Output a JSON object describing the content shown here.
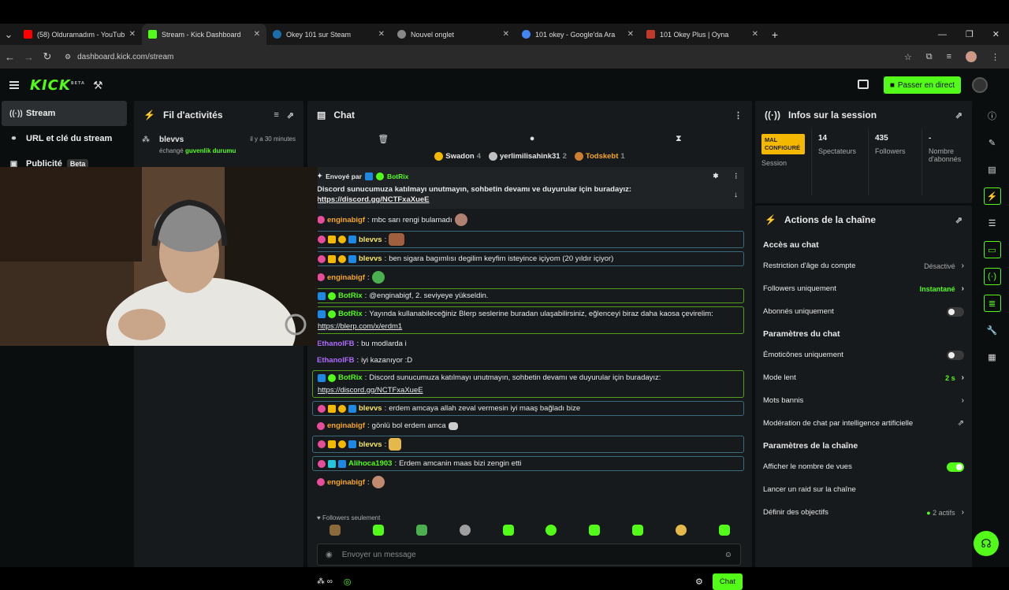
{
  "browser": {
    "tabs": [
      {
        "title": "(58) Olduramadım - YouTube",
        "color": "#ff0000"
      },
      {
        "title": "Stream - Kick Dashboard",
        "color": "#53fc18",
        "active": true
      },
      {
        "title": "Okey 101 sur Steam",
        "color": "#1b6ea8"
      },
      {
        "title": "Nouvel onglet",
        "color": "#888888"
      },
      {
        "title": "101 okey - Google'da Ara",
        "color": "#4285f4"
      },
      {
        "title": "101 Okey Plus | Oyna",
        "color": "#c0392b"
      }
    ],
    "url": "dashboard.kick.com/stream"
  },
  "header": {
    "logo": "KICK",
    "logo_sup": "BETA",
    "go_live": "Passer en direct"
  },
  "sidebar": {
    "items": [
      {
        "label": "Stream",
        "icon": "broadcast-icon"
      },
      {
        "label": "URL et clé du stream",
        "icon": "link-icon"
      },
      {
        "label": "Publicité",
        "icon": "ad-icon",
        "badge": "Beta"
      }
    ]
  },
  "activity": {
    "title": "Fil d'activités",
    "items": [
      {
        "user": "blevvs",
        "action": "échangé",
        "reward": "guvenlik durumu",
        "time": "il y a 30 minutes"
      }
    ]
  },
  "chat": {
    "title": "Chat",
    "top_gifters": [
      {
        "name": "Swadon",
        "count": "4",
        "color": "#f5b800"
      },
      {
        "name": "yerlimilisahink31",
        "count": "2",
        "color": "#c0c0c0"
      },
      {
        "name": "Todskebt",
        "count": "1",
        "color": "#cd7f32"
      }
    ],
    "pinned": {
      "label": "Envoyé par",
      "user": "BotRix",
      "text": "Discord sunucumuza katılmayı unutmayın, sohbetin devamı ve duyurular için buradayız:",
      "link": "https://discord.gg/NCTFxaXueE"
    },
    "messages": [
      {
        "user": "enginabigf",
        "color": "#f5a623",
        "text": "mbc sarı rengi bulamadı"
      },
      {
        "user": "blevvs",
        "color": "#f5e663",
        "text": ""
      },
      {
        "user": "blevvs",
        "color": "#f5e663",
        "text": "ben sigara bagımlısı degilim keyfim isteyince içiyom (20 yıldır içiyor)"
      },
      {
        "user": "enginabigf",
        "color": "#f5a623",
        "text": ""
      },
      {
        "user": "BotRix",
        "color": "#53fc18",
        "text": "@enginabigf, 2. seviyeye yükseldin."
      },
      {
        "user": "BotRix",
        "color": "#53fc18",
        "text": "Yayında kullanabileceğiniz Blerp seslerine buradan ulaşabilirsiniz, eğlenceyi biraz daha kaosa çevirelim:",
        "link": "https://blerp.com/x/erdm1"
      },
      {
        "user": "EthanolFB",
        "color": "#b06cff",
        "text": "bu modlarda i"
      },
      {
        "user": "EthanolFB",
        "color": "#b06cff",
        "text": "iyi kazanıyor :D"
      },
      {
        "user": "BotRix",
        "color": "#53fc18",
        "text": "Discord sunucumuza katılmayı unutmayın, sohbetin devamı ve duyurular için buradayız:",
        "link": "https://discord.gg/NCTFxaXueE"
      },
      {
        "user": "blevvs",
        "color": "#f5e663",
        "text": "erdem amcaya allah zeval vermesin iyi maaş bağladı bize"
      },
      {
        "user": "enginabigf",
        "color": "#f5a623",
        "text": "gönlü bol erdem amca"
      },
      {
        "user": "blevvs",
        "color": "#f5e663",
        "text": ""
      },
      {
        "user": "Alihoca1903",
        "color": "#53fc18",
        "text": "Erdem amcanin maas bizi zengin etti"
      },
      {
        "user": "enginabigf",
        "color": "#f5a623",
        "text": ""
      }
    ],
    "followers_only": "Followers seulement",
    "input_placeholder": "Envoyer un message",
    "send_label": "Chat"
  },
  "session": {
    "title": "Infos sur la session",
    "status": "MAL CONFIGURÉ",
    "status_label": "Session",
    "viewers": "14",
    "viewers_label": "Spectateurs",
    "followers": "435",
    "followers_label": "Followers",
    "subs": "-",
    "subs_label": "Nombre d'abonnés"
  },
  "actions": {
    "title": "Actions de la chaîne",
    "chat_access": "Accès au chat",
    "age_restriction": "Restriction d'âge du compte",
    "age_restriction_value": "Désactivé",
    "followers_only": "Followers uniquement",
    "followers_only_value": "Instantané",
    "subs_only": "Abonnés uniquement",
    "chat_settings": "Paramètres du chat",
    "emotes_only": "Émoticônes uniquement",
    "slow_mode": "Mode lent",
    "slow_mode_value": "2 s",
    "banned_words": "Mots bannis",
    "ai_moderation": "Modération de chat par intelligence artificielle",
    "channel_settings": "Paramètres de la chaîne",
    "show_views": "Afficher le nombre de vues",
    "raid": "Lancer un raid sur la chaîne",
    "goals": "Définir des objectifs",
    "goals_value": "2 actifs"
  }
}
